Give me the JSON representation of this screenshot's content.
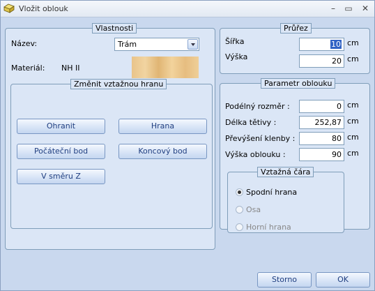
{
  "window": {
    "title": "Vložit oblouk",
    "controls": {
      "minimize": "–",
      "maximize": "▭",
      "close": "✕"
    }
  },
  "vlastnosti": {
    "title": "Vlastnosti",
    "nazev_label": "Název:",
    "nazev_value": "Trám",
    "material_label": "Materiál:",
    "material_value": "NH II"
  },
  "zmenit": {
    "title": "Změnit vztažnou hranu",
    "buttons": {
      "ohranit": "Ohranit",
      "hrana": "Hrana",
      "pocatecni": "Počáteční bod",
      "koncovy": "Koncový bod",
      "vsmeru": "V směru Z"
    }
  },
  "prurez": {
    "title": "Průřez",
    "sirka_label": "Šířka",
    "sirka_value": "10",
    "vyska_label": "Výška",
    "vyska_value": "20",
    "unit": "cm"
  },
  "parametr": {
    "title": "Parametr oblouku",
    "rows": [
      {
        "label": "Podélný rozměr :",
        "value": "0"
      },
      {
        "label": "Délka tětivy :",
        "value": "252,87"
      },
      {
        "label": "Převýšení klenby :",
        "value": "80"
      },
      {
        "label": "Výška oblouku :",
        "value": "90"
      }
    ],
    "unit": "cm"
  },
  "vztazna": {
    "title": "Vztažná čára",
    "options": [
      "Spodní hrana",
      "Osa",
      "Horní hrana"
    ],
    "selected": "Spodní hrana"
  },
  "footer": {
    "storno": "Storno",
    "ok": "OK"
  }
}
